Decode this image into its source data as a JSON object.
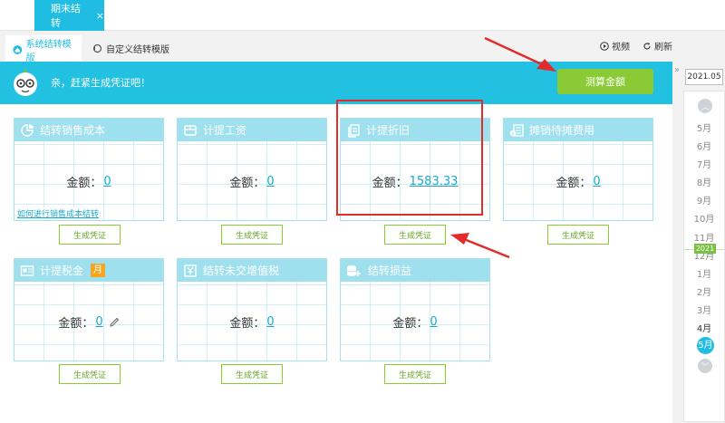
{
  "top_tab": {
    "label": "期末结转",
    "close": "×"
  },
  "template_tabs": [
    {
      "label": "系统结转模版"
    },
    {
      "label": "自定义结转模版"
    }
  ],
  "toolbar": {
    "video": "视频",
    "refresh": "刷新"
  },
  "banner": {
    "text": "亲，赶紧生成凭证吧！",
    "calc_button": "测算金额"
  },
  "amount_label": "金额：",
  "generate_label": "生成凭证",
  "cards": [
    {
      "title": "结转销售成本",
      "amount": "0",
      "icon": "chart-icon",
      "link": "如何进行销售成本结转"
    },
    {
      "title": "计提工资",
      "amount": "0",
      "icon": "wallet-icon"
    },
    {
      "title": "计提折旧",
      "amount": "1583.33",
      "icon": "copy-icon"
    },
    {
      "title": "摊销待摊费用",
      "amount": "0",
      "icon": "money-icon"
    },
    {
      "title": "计提税金",
      "amount": "0",
      "icon": "tax-icon",
      "badge": "月"
    },
    {
      "title": "结转未交增值税",
      "amount": "0",
      "icon": "yen-icon"
    },
    {
      "title": "结转损益",
      "amount": "0",
      "icon": "coins-icon"
    }
  ],
  "date_panel": {
    "current": "2021.05",
    "toggle": "»",
    "months_2020": [
      "5月",
      "6月",
      "7月",
      "8月",
      "9月",
      "10月",
      "11月",
      "12月"
    ],
    "year_tag": "2021",
    "months_2021": [
      "1月",
      "2月",
      "3月",
      "4月"
    ],
    "selected": "5月"
  },
  "colors": {
    "accent": "#20bde3",
    "green": "#8acb35",
    "card_header": "#9ee0ee",
    "highlight": "#e22b2b"
  }
}
